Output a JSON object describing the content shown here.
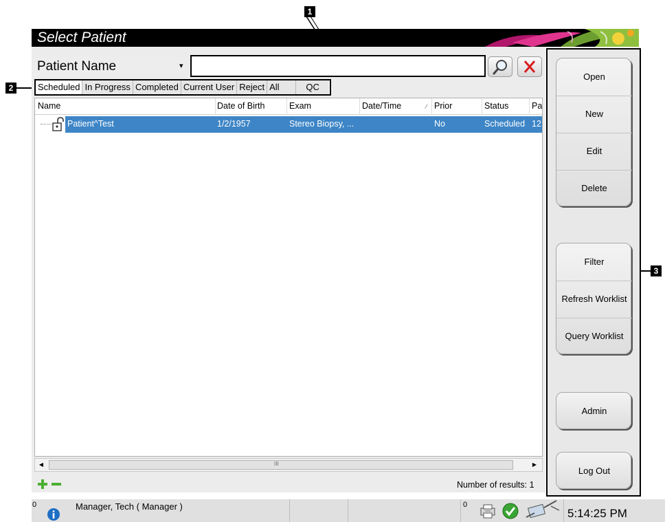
{
  "callouts": [
    "1",
    "2",
    "3"
  ],
  "title": "Select Patient",
  "search": {
    "type_label": "Patient Name",
    "caret": "▾",
    "value": "",
    "search_icon": "magnifier-icon",
    "clear_icon": "red-x-icon"
  },
  "tabs": [
    {
      "label": "Scheduled",
      "active": true
    },
    {
      "label": "In Progress",
      "active": false
    },
    {
      "label": "Completed",
      "active": false
    },
    {
      "label": "Current User",
      "active": false
    },
    {
      "label": "Reject",
      "active": false
    },
    {
      "label": "All",
      "active": false
    },
    {
      "label": "QC",
      "active": false
    }
  ],
  "table": {
    "columns": [
      "Name",
      "Date of Birth",
      "Exam",
      "Date/Time",
      "Prior",
      "Status",
      "Pa"
    ],
    "rows": [
      {
        "name": "Patient^Test",
        "dob": "1/2/1957",
        "exam": "Stereo Biopsy, ...",
        "datetime": "",
        "prior": "No",
        "status": "Scheduled",
        "pa": "12:",
        "icon": "unlocked-padlock-icon"
      }
    ],
    "scroll_grip": "III",
    "results": "Number of results: 1"
  },
  "actions": {
    "group1": [
      "Open",
      "New",
      "Edit",
      "Delete"
    ],
    "group2": [
      "Filter",
      "Refresh Worklist",
      "Query Worklist"
    ],
    "admin": "Admin",
    "logout": "Log Out"
  },
  "status_bar": {
    "left_count": "0",
    "user": "Manager, Tech ( Manager )",
    "right_count": "0",
    "clock": "5:14:25 PM"
  },
  "colors": {
    "selection": "#3d85c6",
    "panel": "#ececec",
    "clear_x": "#d81e1e",
    "check": "#3aa534"
  }
}
